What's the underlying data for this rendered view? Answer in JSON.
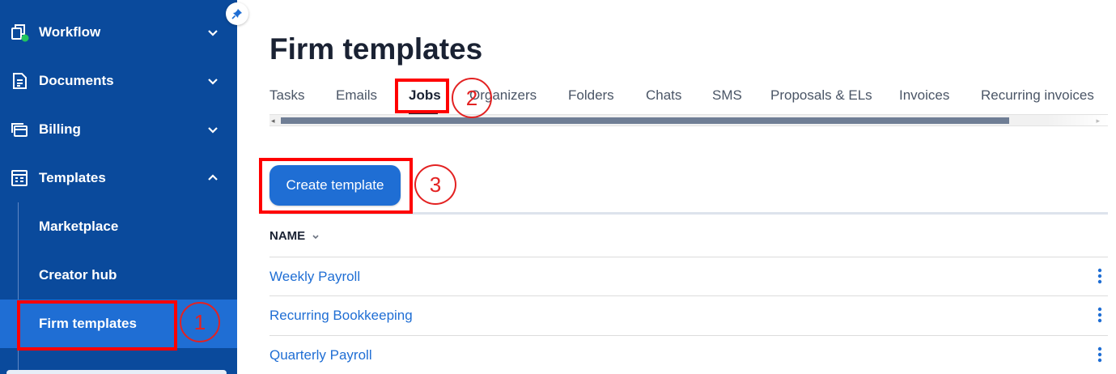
{
  "sidebar": {
    "items": [
      {
        "label": "Workflow",
        "icon": "workflow-icon",
        "chevron": "down"
      },
      {
        "label": "Documents",
        "icon": "document-icon",
        "chevron": "down"
      },
      {
        "label": "Billing",
        "icon": "billing-icon",
        "chevron": "down"
      },
      {
        "label": "Templates",
        "icon": "templates-icon",
        "chevron": "up"
      }
    ],
    "subitems": [
      {
        "label": "Marketplace"
      },
      {
        "label": "Creator hub"
      },
      {
        "label": "Firm templates",
        "active": true
      }
    ],
    "background_color": "#0a4a9c",
    "active_color": "#1f6ed4"
  },
  "page": {
    "title": "Firm templates"
  },
  "tabs": [
    {
      "label": "Tasks"
    },
    {
      "label": "Emails"
    },
    {
      "label": "Jobs",
      "active": true
    },
    {
      "label": "Organizers"
    },
    {
      "label": "Folders"
    },
    {
      "label": "Chats"
    },
    {
      "label": "SMS"
    },
    {
      "label": "Proposals & ELs"
    },
    {
      "label": "Invoices"
    },
    {
      "label": "Recurring invoices"
    }
  ],
  "create_button": {
    "label": "Create template"
  },
  "table": {
    "column_header": "NAME",
    "rows": [
      {
        "name": "Weekly Payroll"
      },
      {
        "name": "Recurring Bookkeeping"
      },
      {
        "name": "Quarterly Payroll"
      }
    ]
  },
  "annotations": [
    {
      "number": "1"
    },
    {
      "number": "2"
    },
    {
      "number": "3"
    }
  ],
  "colors": {
    "accent": "#1f6ed4",
    "link": "#1f6ed4",
    "annotation": "#ff0000",
    "status_dot": "#22c55e"
  }
}
